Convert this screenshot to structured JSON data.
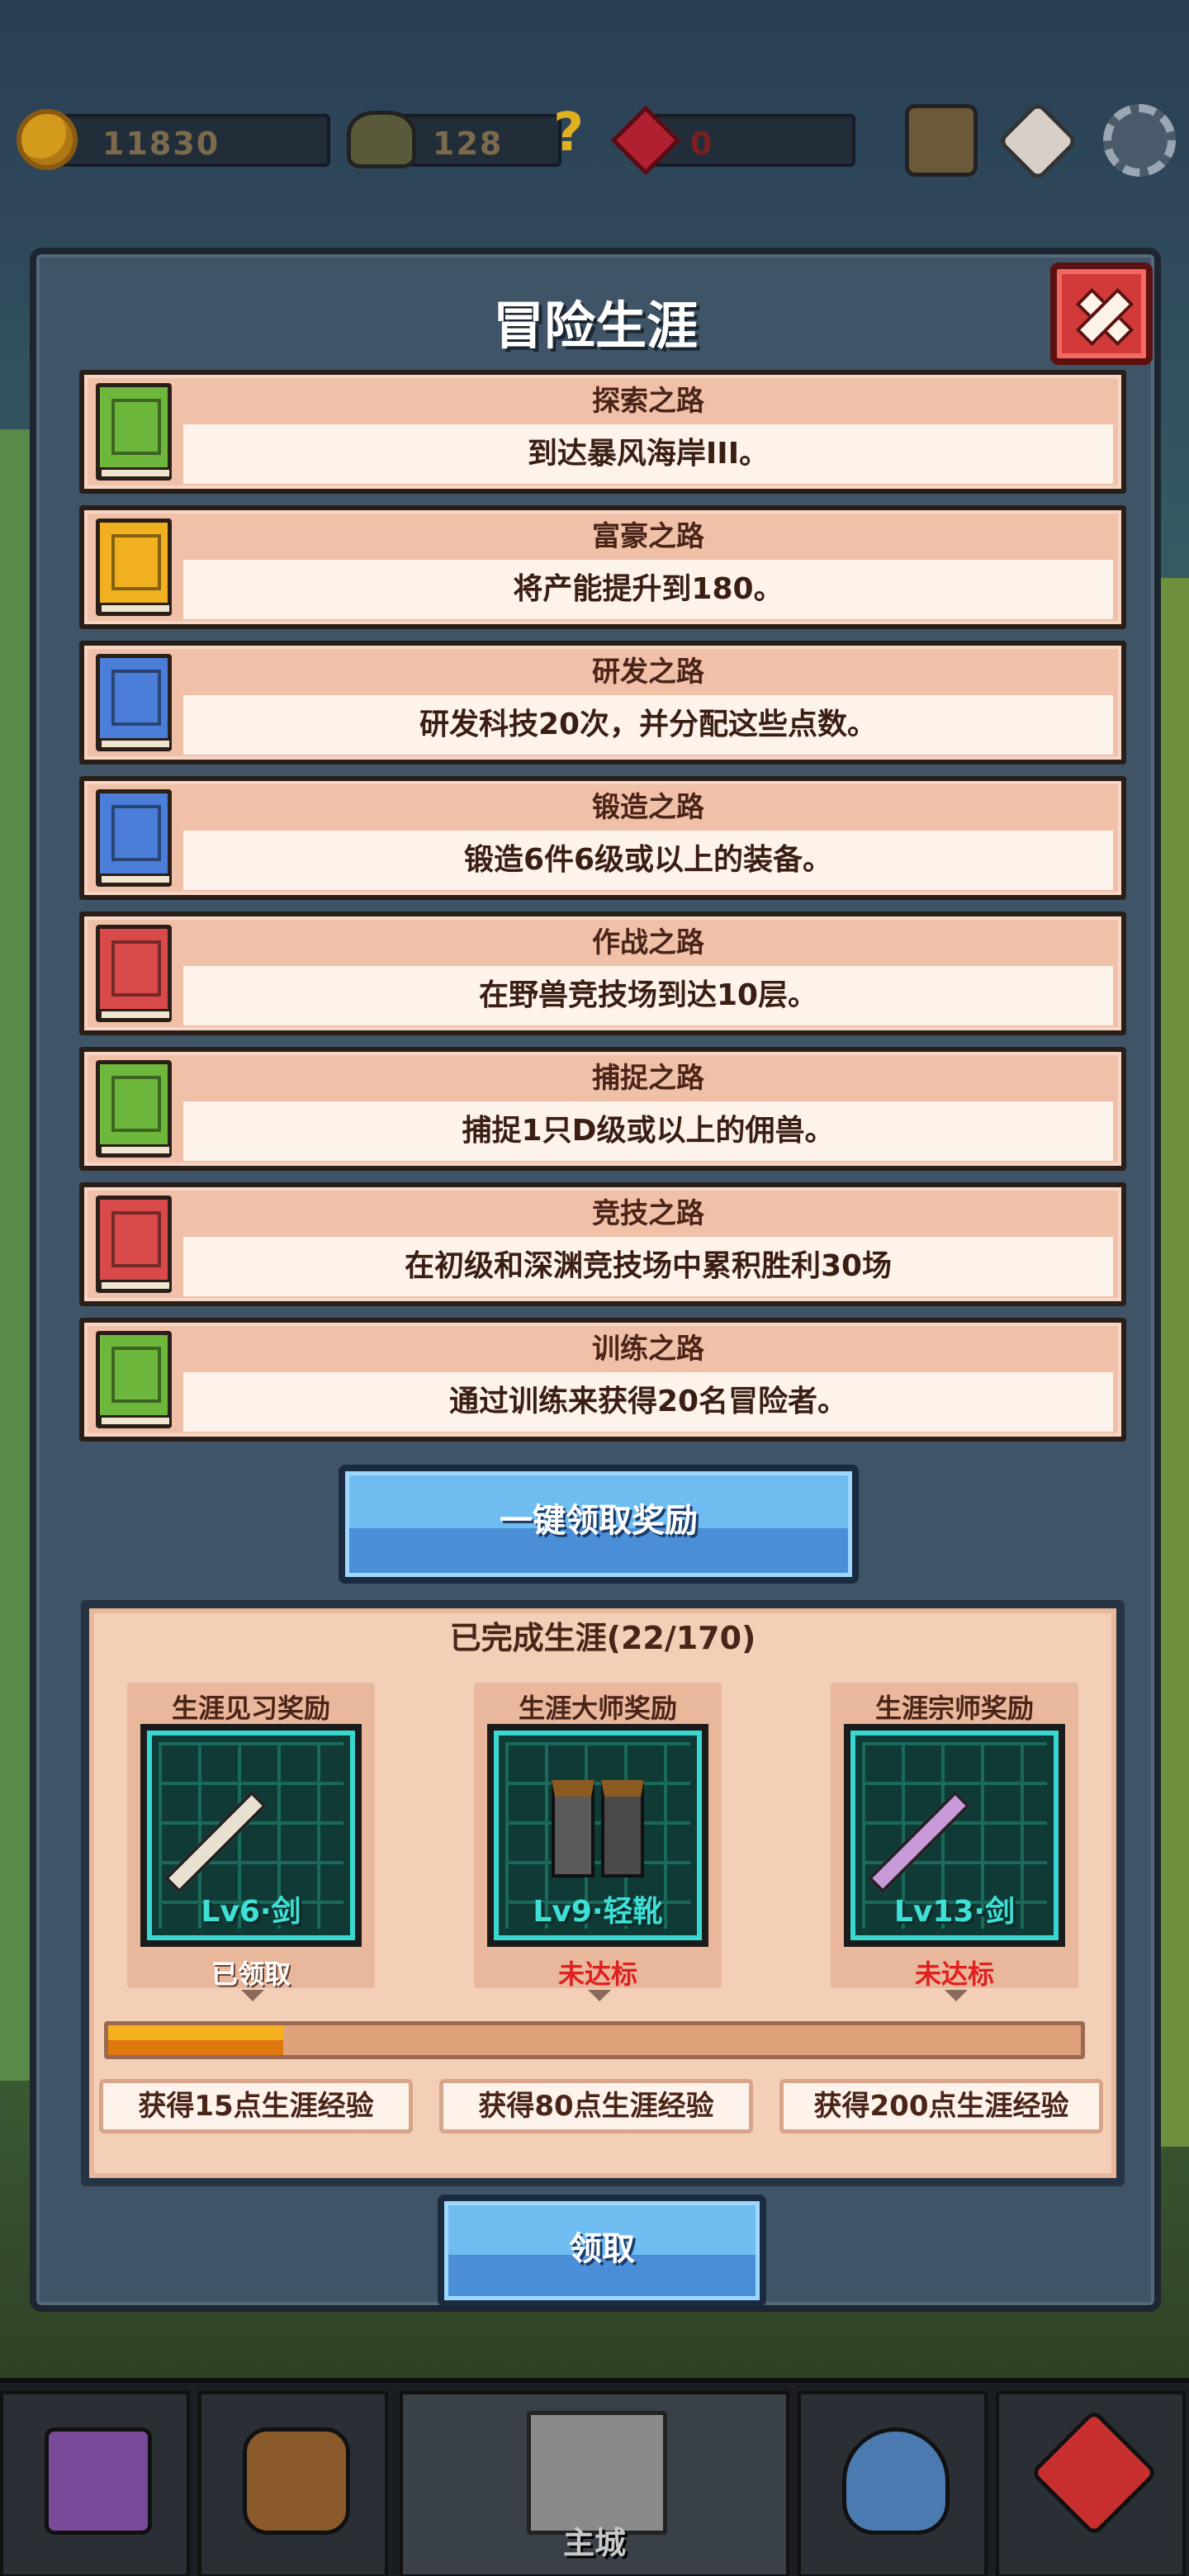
{
  "resources": {
    "gold": "11830",
    "beast": "128",
    "gem": "0"
  },
  "panel": {
    "title": "冒险生涯"
  },
  "careers": [
    {
      "title": "探索之路",
      "desc": "到达暴风海岸III。",
      "color": "#6db83c"
    },
    {
      "title": "富豪之路",
      "desc": "将产能提升到180。",
      "color": "#f0b020"
    },
    {
      "title": "研发之路",
      "desc": "研发科技20次，并分配这些点数。",
      "color": "#4a7ed8"
    },
    {
      "title": "锻造之路",
      "desc": "锻造6件6级或以上的装备。",
      "color": "#4a7ed8"
    },
    {
      "title": "作战之路",
      "desc": "在野兽竞技场到达10层。",
      "color": "#d84a4a"
    },
    {
      "title": "捕捉之路",
      "desc": "捕捉1只D级或以上的佣兽。",
      "color": "#6db83c"
    },
    {
      "title": "竞技之路",
      "desc": "在初级和深渊竞技场中累积胜利30场",
      "color": "#d84a4a"
    },
    {
      "title": "训练之路",
      "desc": "通过训练来获得20名冒险者。",
      "color": "#6db83c"
    }
  ],
  "claim_all_label": "一键领取奖励",
  "career_progress": {
    "header": "已完成生涯(22/170)",
    "progress_fraction": 0.18,
    "rewards": [
      {
        "name": "生涯见习奖励",
        "item": "Lv6·剑",
        "status": "已领取",
        "status_color": "#ffffff",
        "xp": "获得15点生涯经验"
      },
      {
        "name": "生涯大师奖励",
        "item": "Lv9·轻靴",
        "status": "未达标",
        "status_color": "#e02020",
        "xp": "获得80点生涯经验"
      },
      {
        "name": "生涯宗师奖励",
        "item": "Lv13·剑",
        "status": "未达标",
        "status_color": "#e02020",
        "xp": "获得200点生涯经验"
      }
    ]
  },
  "claim_label": "领取",
  "bottom_nav": {
    "center_label": "主城"
  }
}
